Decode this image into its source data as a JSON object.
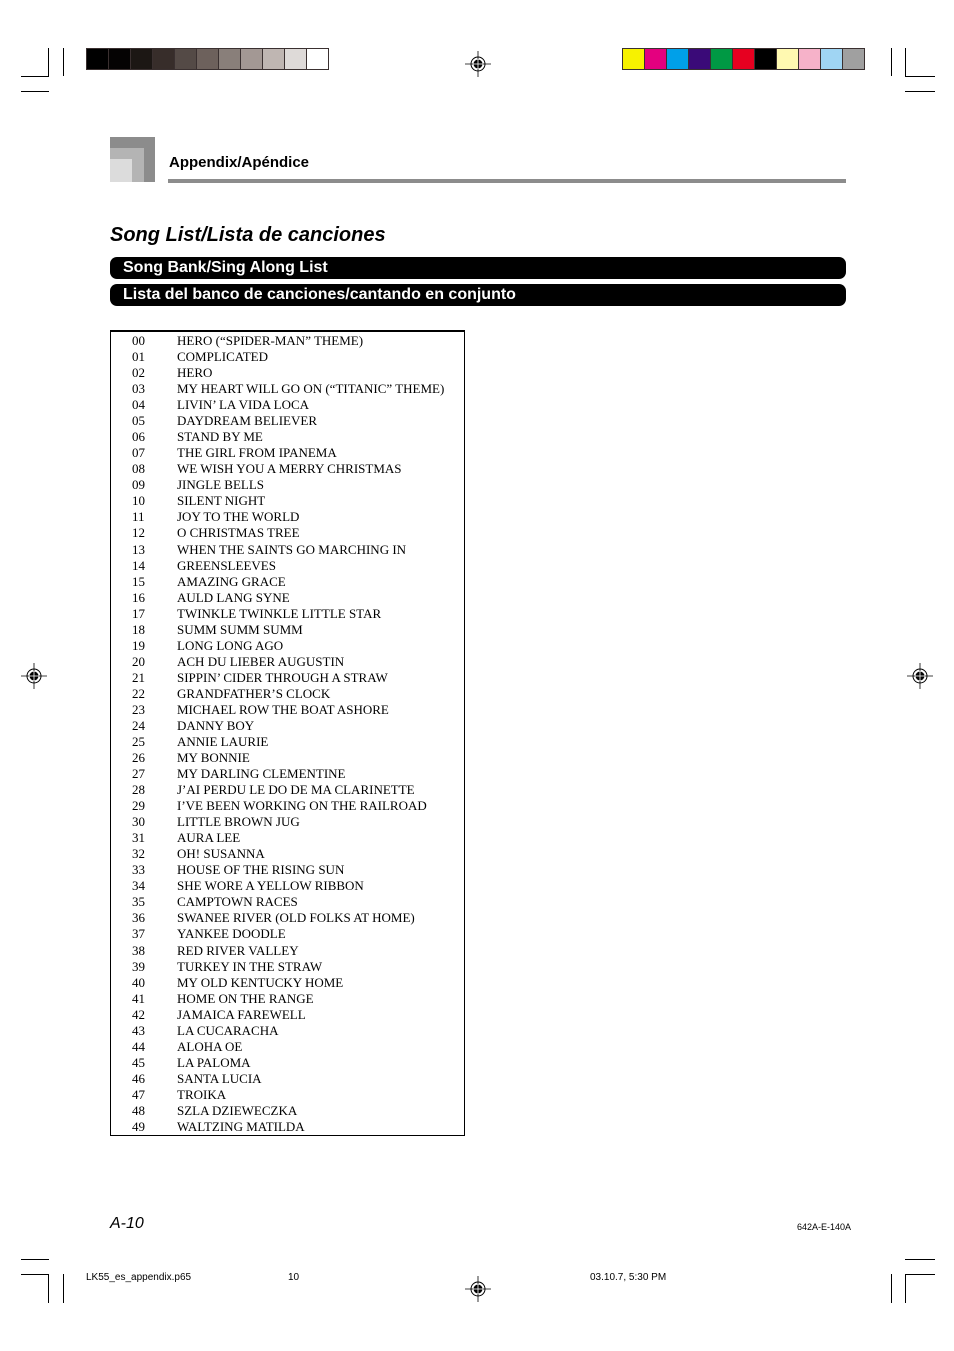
{
  "color_bars": {
    "grayscale": [
      "#000000",
      "#050303",
      "#1c1714",
      "#372d2a",
      "#544a46",
      "#6d615c",
      "#897f7a",
      "#a39894",
      "#bfb6b2",
      "#dedad8",
      "#ffffff"
    ],
    "colors": [
      "#f7f200",
      "#e4007f",
      "#00a0e9",
      "#3a0a78",
      "#009944",
      "#e60020",
      "#000000",
      "#fff9b1",
      "#f6b2c9",
      "#a0d5f3",
      "#a0a0a0"
    ]
  },
  "header": {
    "section": "Appendix/Apéndice"
  },
  "page_title": "Song List/Lista de canciones",
  "bars": {
    "english": "Song Bank/Sing Along List",
    "spanish": "Lista del banco de canciones/cantando en conjunto"
  },
  "songs": [
    {
      "num": "00",
      "title": "HERO (“SPIDER-MAN” THEME)"
    },
    {
      "num": "01",
      "title": "COMPLICATED"
    },
    {
      "num": "02",
      "title": "HERO"
    },
    {
      "num": "03",
      "title": "MY HEART WILL GO ON (“TITANIC” THEME)"
    },
    {
      "num": "04",
      "title": "LIVIN’ LA VIDA LOCA"
    },
    {
      "num": "05",
      "title": "DAYDREAM BELIEVER"
    },
    {
      "num": "06",
      "title": "STAND BY ME"
    },
    {
      "num": "07",
      "title": "THE GIRL FROM IPANEMA"
    },
    {
      "num": "08",
      "title": "WE WISH YOU A MERRY CHRISTMAS"
    },
    {
      "num": "09",
      "title": "JINGLE BELLS"
    },
    {
      "num": "10",
      "title": "SILENT NIGHT"
    },
    {
      "num": "11",
      "title": "JOY TO THE WORLD"
    },
    {
      "num": "12",
      "title": "O CHRISTMAS TREE"
    },
    {
      "num": "13",
      "title": "WHEN THE SAINTS GO MARCHING IN"
    },
    {
      "num": "14",
      "title": "GREENSLEEVES"
    },
    {
      "num": "15",
      "title": "AMAZING GRACE"
    },
    {
      "num": "16",
      "title": "AULD LANG SYNE"
    },
    {
      "num": "17",
      "title": "TWINKLE TWINKLE LITTLE STAR"
    },
    {
      "num": "18",
      "title": "SUMM SUMM SUMM"
    },
    {
      "num": "19",
      "title": "LONG LONG AGO"
    },
    {
      "num": "20",
      "title": "ACH DU LIEBER AUGUSTIN"
    },
    {
      "num": "21",
      "title": "SIPPIN’ CIDER THROUGH A STRAW"
    },
    {
      "num": "22",
      "title": "GRANDFATHER’S CLOCK"
    },
    {
      "num": "23",
      "title": "MICHAEL ROW THE BOAT ASHORE"
    },
    {
      "num": "24",
      "title": "DANNY BOY"
    },
    {
      "num": "25",
      "title": "ANNIE LAURIE"
    },
    {
      "num": "26",
      "title": "MY BONNIE"
    },
    {
      "num": "27",
      "title": "MY DARLING CLEMENTINE"
    },
    {
      "num": "28",
      "title": "J’AI PERDU LE DO DE MA CLARINETTE"
    },
    {
      "num": "29",
      "title": "I’VE BEEN WORKING ON THE RAILROAD"
    },
    {
      "num": "30",
      "title": "LITTLE BROWN JUG"
    },
    {
      "num": "31",
      "title": "AURA LEE"
    },
    {
      "num": "32",
      "title": "OH! SUSANNA"
    },
    {
      "num": "33",
      "title": "HOUSE OF THE RISING SUN"
    },
    {
      "num": "34",
      "title": "SHE WORE A YELLOW RIBBON"
    },
    {
      "num": "35",
      "title": "CAMPTOWN RACES"
    },
    {
      "num": "36",
      "title": "SWANEE RIVER (OLD FOLKS AT HOME)"
    },
    {
      "num": "37",
      "title": "YANKEE DOODLE"
    },
    {
      "num": "38",
      "title": "RED RIVER VALLEY"
    },
    {
      "num": "39",
      "title": "TURKEY IN THE STRAW"
    },
    {
      "num": "40",
      "title": "MY OLD KENTUCKY HOME"
    },
    {
      "num": "41",
      "title": "HOME ON THE RANGE"
    },
    {
      "num": "42",
      "title": "JAMAICA FAREWELL"
    },
    {
      "num": "43",
      "title": "LA CUCARACHA"
    },
    {
      "num": "44",
      "title": "ALOHA OE"
    },
    {
      "num": "45",
      "title": "LA PALOMA"
    },
    {
      "num": "46",
      "title": "SANTA LUCIA"
    },
    {
      "num": "47",
      "title": "TROIKA"
    },
    {
      "num": "48",
      "title": "SZLA DZIEWECZKA"
    },
    {
      "num": "49",
      "title": "WALTZING MATILDA"
    }
  ],
  "footer": {
    "page_number": "A-10",
    "doc_code": "642A-E-140A",
    "file_name": "LK55_es_appendix.p65",
    "file_page": "10",
    "timestamp": "03.10.7, 5:30 PM"
  }
}
